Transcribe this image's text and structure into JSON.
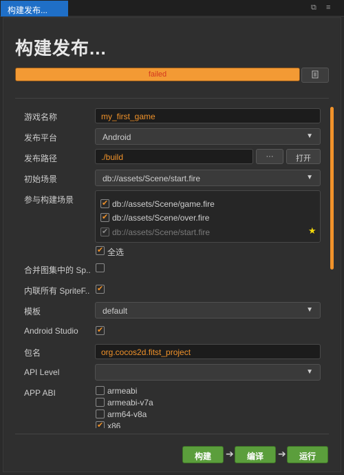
{
  "window": {
    "tab_title": "构建发布...",
    "ctrl_restore": "⧉",
    "ctrl_menu": "≡"
  },
  "header": {
    "title": "构建发布...",
    "progress_text": "failed",
    "progress": 1.0,
    "open_icon": "folder-icon"
  },
  "form": {
    "game_name": {
      "label": "游戏名称",
      "value": "my_first_game"
    },
    "platform": {
      "label": "发布平台",
      "value": "Android"
    },
    "build_path": {
      "label": "发布路径",
      "value": "./build",
      "browse_label": "···",
      "open_label": "打开"
    },
    "start_scene": {
      "label": "初始场景",
      "value": "db://assets/Scene/start.fire"
    },
    "build_scenes": {
      "label": "参与构建场景",
      "items": [
        {
          "label": "db://assets/Scene/game.fire",
          "checked": true
        },
        {
          "label": "db://assets/Scene/over.fire",
          "checked": true
        },
        {
          "label": "db://assets/Scene/start.fire",
          "checked": true
        }
      ],
      "select_all_label": "全选"
    },
    "merge_atlas": {
      "label": "合并图集中的 Sp.."
    },
    "inline_sprite": {
      "label": "内联所有 SpriteF.."
    },
    "template": {
      "label": "模板",
      "value": "default"
    },
    "android_studio": {
      "label": "Android Studio"
    },
    "package_name": {
      "label": "包名",
      "value": "org.cocos2d.fitst_project"
    },
    "api_level": {
      "label": "API Level",
      "value": ""
    },
    "app_abi": {
      "label": "APP ABI",
      "options": [
        {
          "label": "armeabi",
          "checked": false
        },
        {
          "label": "armeabi-v7a",
          "checked": false
        },
        {
          "label": "arm64-v8a",
          "checked": false
        },
        {
          "label": "x86",
          "checked": true
        }
      ]
    }
  },
  "footer": {
    "build_label": "构建",
    "compile_label": "编译",
    "run_label": "运行",
    "arrow": "➔"
  },
  "colors": {
    "accent": "#f0922a",
    "tab_active": "#1f6fc7",
    "error_text": "#d4371e",
    "action_green": "#5b9e3c"
  }
}
